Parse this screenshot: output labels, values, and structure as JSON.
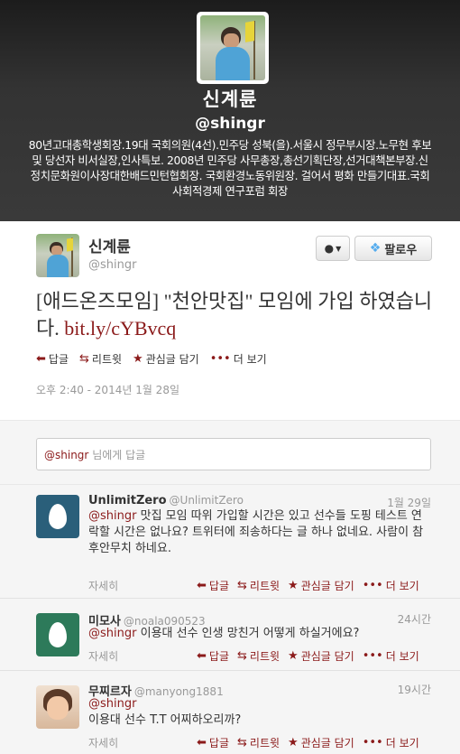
{
  "profile": {
    "name": "신계륜",
    "handle": "@shingr",
    "bio": "80년고대총학생회장.19대 국회의원(4선).민주당 성북(을).서울시 정무부시장.노무현 후보 및 당선자 비서실장,인사특보. 2008년 민주당 사무총장,총선기획단장,선거대책본부장.신정치문화원이사장대한배드민턴협회장. 국회환경노동위원장. 걸어서 평화 만들기대표.국회 사회적경제 연구포럼 회장"
  },
  "tweet": {
    "author_name": "신계륜",
    "author_handle": "@shingr",
    "text": "[애드온즈모임] \"천안맛집\" 모임에 가입 하였습니다.",
    "link": "bit.ly/cYBvcq",
    "follow_label": "팔로우",
    "timestamp": "오후 2:40 - 2014년 1월 28일",
    "actions": {
      "reply": "답글",
      "retweet": "리트윗",
      "favorite": "관심글 담기",
      "more": "더 보기"
    }
  },
  "reply_box": {
    "mention": "@shingr",
    "placeholder": "님에게 답글"
  },
  "replies": [
    {
      "name": "UnlimitZero",
      "handle": "@UnlimitZero",
      "time": "1월 29일",
      "mention": "@shingr",
      "text": "맛집 모임 따위 가입할 시간은 있고 선수들 도핑 테스트 연락할 시간은 없나요? 트위터에 죄송하다는 글 하나 없네요. 사람이 참 후안무치 하네요.",
      "detail": "자세히",
      "actions": {
        "reply": "답글",
        "retweet": "리트윗",
        "favorite": "관심글 담기",
        "more": "더 보기"
      }
    },
    {
      "name": "미모사",
      "handle": "@noala090523",
      "time": "24시간",
      "mention": "@shingr",
      "text": "이용대 선수 인생 망친거 어떻게 하실거에요?",
      "detail": "자세히",
      "actions": {
        "reply": "답글",
        "retweet": "리트윗",
        "favorite": "관심글 담기",
        "more": "더 보기"
      }
    },
    {
      "name": "무찌르자",
      "handle": "@manyong1881",
      "time": "19시간",
      "mention": "@shingr",
      "text": "이용대 선수 T.T 어찌하오리까?",
      "detail": "자세히",
      "actions": {
        "reply": "답글",
        "retweet": "리트윗",
        "favorite": "관심글 담기",
        "more": "더 보기"
      }
    }
  ],
  "colors": {
    "accent": "#8b1a1a",
    "header_dark": "#2b2b2b",
    "muted": "#999999"
  }
}
